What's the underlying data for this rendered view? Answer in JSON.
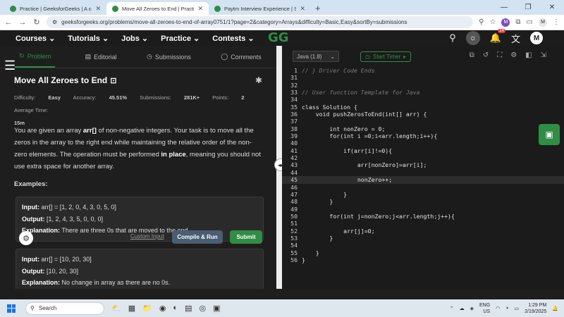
{
  "browser": {
    "tabs": [
      {
        "title": "Practice | GeeksforGeeks | A co",
        "active": false
      },
      {
        "title": "Move All Zeroes to End | Practic",
        "active": true
      },
      {
        "title": "Paytm Interview Experience | Se",
        "active": false
      }
    ],
    "url": "geeksforgeeks.org/problems/move-all-zeroes-to-end-of-array0751/1?page=2&category=Arrays&difficulty=Basic,Easy&sortBy=submissions",
    "profile_initial": "M"
  },
  "sitenav": {
    "items": [
      "Courses ⌄",
      "Tutorials ⌄",
      "Jobs ⌄",
      "Practice ⌄",
      "Contests ⌄"
    ],
    "logo": "GG",
    "notif_count": "24",
    "user_initial": "M"
  },
  "tabs": {
    "problem": "Problem",
    "editorial": "Editorial",
    "submissions": "Submissions",
    "comments": "Comments"
  },
  "problem": {
    "title": "Move All Zeroes to End",
    "difficulty_label": "Difficulty:",
    "difficulty": "Easy",
    "accuracy_label": "Accuracy:",
    "accuracy": "45.51%",
    "submissions_label": "Submissions:",
    "submissions": "281K+",
    "points_label": "Points:",
    "points": "2",
    "avgtime_label": "Average Time:",
    "avgtime": "15m",
    "desc_1": "You are given an array ",
    "desc_arr": "arr[]",
    "desc_2": " of non-negative integers. Your task is to move all the zeros in the array to the right end while maintaining the relative order of the non-zero elements. The operation must be performed ",
    "desc_inplace": "in place",
    "desc_3": ", meaning you should not use extra space for another array.",
    "examples_label": "Examples:",
    "examples": [
      {
        "input": "arr[] = [1, 2, 0, 4, 3, 0, 5, 0]",
        "output": "[1, 2, 4, 3, 5, 0, 0, 0]",
        "explanation": "There are three 0s that are moved to the end."
      },
      {
        "input": "arr[] = [10, 20, 30]",
        "output": "[10, 20, 30]",
        "explanation": "No change in array as there are no 0s."
      }
    ],
    "input_label": "Input:",
    "output_label": "Output:",
    "explanation_label": "Explanation:"
  },
  "editor": {
    "language": "Java (1.8)",
    "timer_label": "Start Timer",
    "code_lines": [
      {
        "n": "1",
        "text": "// } Driver Code Ends",
        "cls": "cm"
      },
      {
        "n": "31",
        "text": "",
        "cls": "ct"
      },
      {
        "n": "32",
        "text": "",
        "cls": "ct"
      },
      {
        "n": "33",
        "text": "// User function Template for Java",
        "cls": "cm"
      },
      {
        "n": "34",
        "text": "",
        "cls": "ct"
      },
      {
        "n": "35",
        "text": "class Solution {",
        "cls": "ct"
      },
      {
        "n": "36",
        "text": "    void pushZerosToEnd(int[] arr) {",
        "cls": "ct"
      },
      {
        "n": "37",
        "text": "",
        "cls": "ct"
      },
      {
        "n": "38",
        "text": "        int nonZero = 0;",
        "cls": "ct"
      },
      {
        "n": "39",
        "text": "        for(int i =0;i<arr.length;i++){",
        "cls": "ct"
      },
      {
        "n": "40",
        "text": "",
        "cls": "ct"
      },
      {
        "n": "41",
        "text": "            if(arr[i]!=0){",
        "cls": "ct"
      },
      {
        "n": "42",
        "text": "",
        "cls": "ct"
      },
      {
        "n": "43",
        "text": "                arr[nonZero]=arr[i];",
        "cls": "ct"
      },
      {
        "n": "44",
        "text": "",
        "cls": "ct"
      },
      {
        "n": "45",
        "text": "                nonZero++;",
        "cls": "ct hl"
      },
      {
        "n": "46",
        "text": "",
        "cls": "ct"
      },
      {
        "n": "47",
        "text": "            }",
        "cls": "ct"
      },
      {
        "n": "48",
        "text": "        }",
        "cls": "ct"
      },
      {
        "n": "49",
        "text": "",
        "cls": "ct"
      },
      {
        "n": "50",
        "text": "        for(int j=nonZero;j<arr.length;j++){",
        "cls": "ct"
      },
      {
        "n": "51",
        "text": "",
        "cls": "ct"
      },
      {
        "n": "52",
        "text": "            arr[j]=0;",
        "cls": "ct"
      },
      {
        "n": "53",
        "text": "        }",
        "cls": "ct"
      },
      {
        "n": "54",
        "text": "",
        "cls": "ct"
      },
      {
        "n": "55",
        "text": "    }",
        "cls": "ct"
      },
      {
        "n": "56",
        "text": "}",
        "cls": "ct"
      }
    ],
    "custom_input": "Custom Input",
    "compile_label": "Compile & Run",
    "submit_label": "Submit"
  },
  "taskbar": {
    "search_placeholder": "Search",
    "lang": "ENG",
    "region": "US",
    "time": "1:29 PM",
    "date": "2/19/2025"
  },
  "colors": {
    "accent": "#2f8d46",
    "compile": "#4a5d73"
  }
}
